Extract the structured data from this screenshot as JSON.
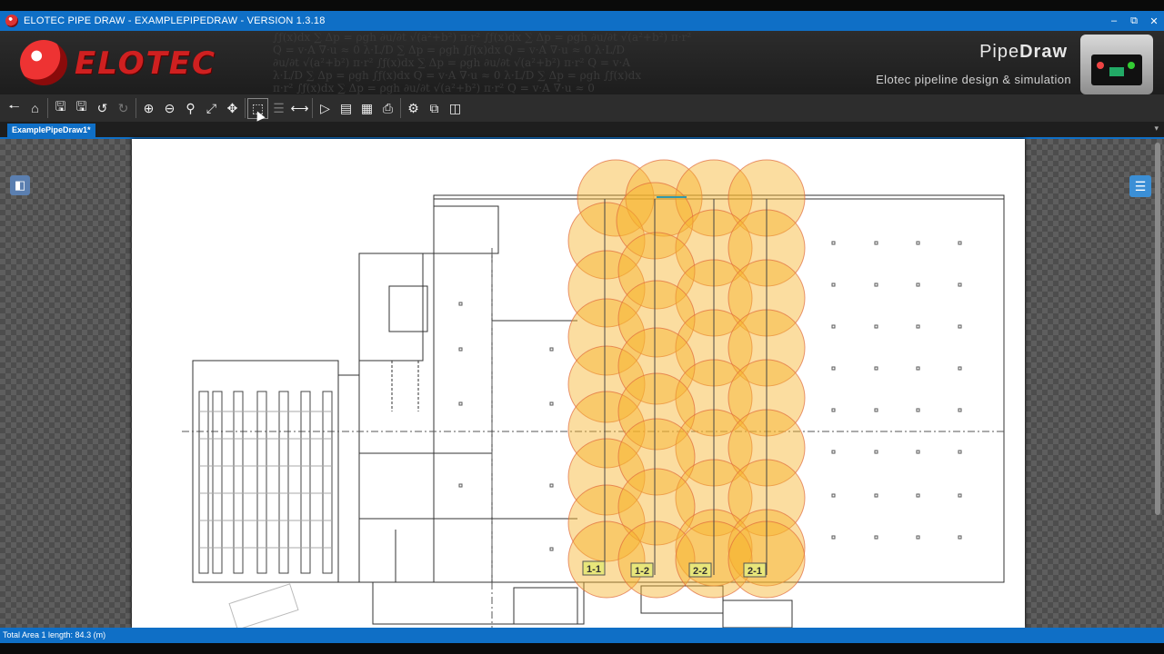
{
  "window": {
    "title": "ELOTEC PIPE DRAW - EXAMPLEPIPEDRAW - VERSION 1.3.18",
    "buttons": [
      "minimize",
      "restore",
      "close"
    ]
  },
  "banner": {
    "logo_text": "ELOTEC",
    "product_prefix": "Pipe",
    "product_suffix": "Draw",
    "tagline": "Elotec pipeline design & simulation"
  },
  "toolbar": {
    "groups": [
      [
        {
          "icon": "back-arrow-icon"
        },
        {
          "icon": "home-icon"
        }
      ],
      [
        {
          "icon": "save-icon"
        },
        {
          "icon": "save-as-icon"
        },
        {
          "icon": "undo-icon"
        },
        {
          "icon": "redo-icon",
          "disabled": true
        }
      ],
      [
        {
          "icon": "zoom-in-icon"
        },
        {
          "icon": "zoom-out-icon"
        },
        {
          "icon": "zoom-icon"
        },
        {
          "icon": "fit-to-screen-icon"
        },
        {
          "icon": "pan-icon"
        }
      ],
      [
        {
          "icon": "select-area-icon",
          "active": true
        },
        {
          "icon": "list-icon",
          "disabled": true
        },
        {
          "icon": "measure-icon"
        }
      ],
      [
        {
          "icon": "play-simulation-icon"
        },
        {
          "icon": "cart-icon"
        },
        {
          "icon": "report-icon"
        },
        {
          "icon": "print-icon"
        }
      ],
      [
        {
          "icon": "settings-icon"
        },
        {
          "icon": "export-icon"
        },
        {
          "icon": "info-icon"
        }
      ]
    ]
  },
  "tabs": [
    {
      "label": "ExamplePipeDraw1*"
    }
  ],
  "drawing": {
    "coverage_color": "#f7b42c",
    "coverage_stroke": "#e06a3c",
    "zone_labels": [
      "1-1",
      "1-2",
      "2-2",
      "2-1"
    ]
  },
  "status": {
    "text": "Total Area 1 length: 84.3 (m)"
  }
}
